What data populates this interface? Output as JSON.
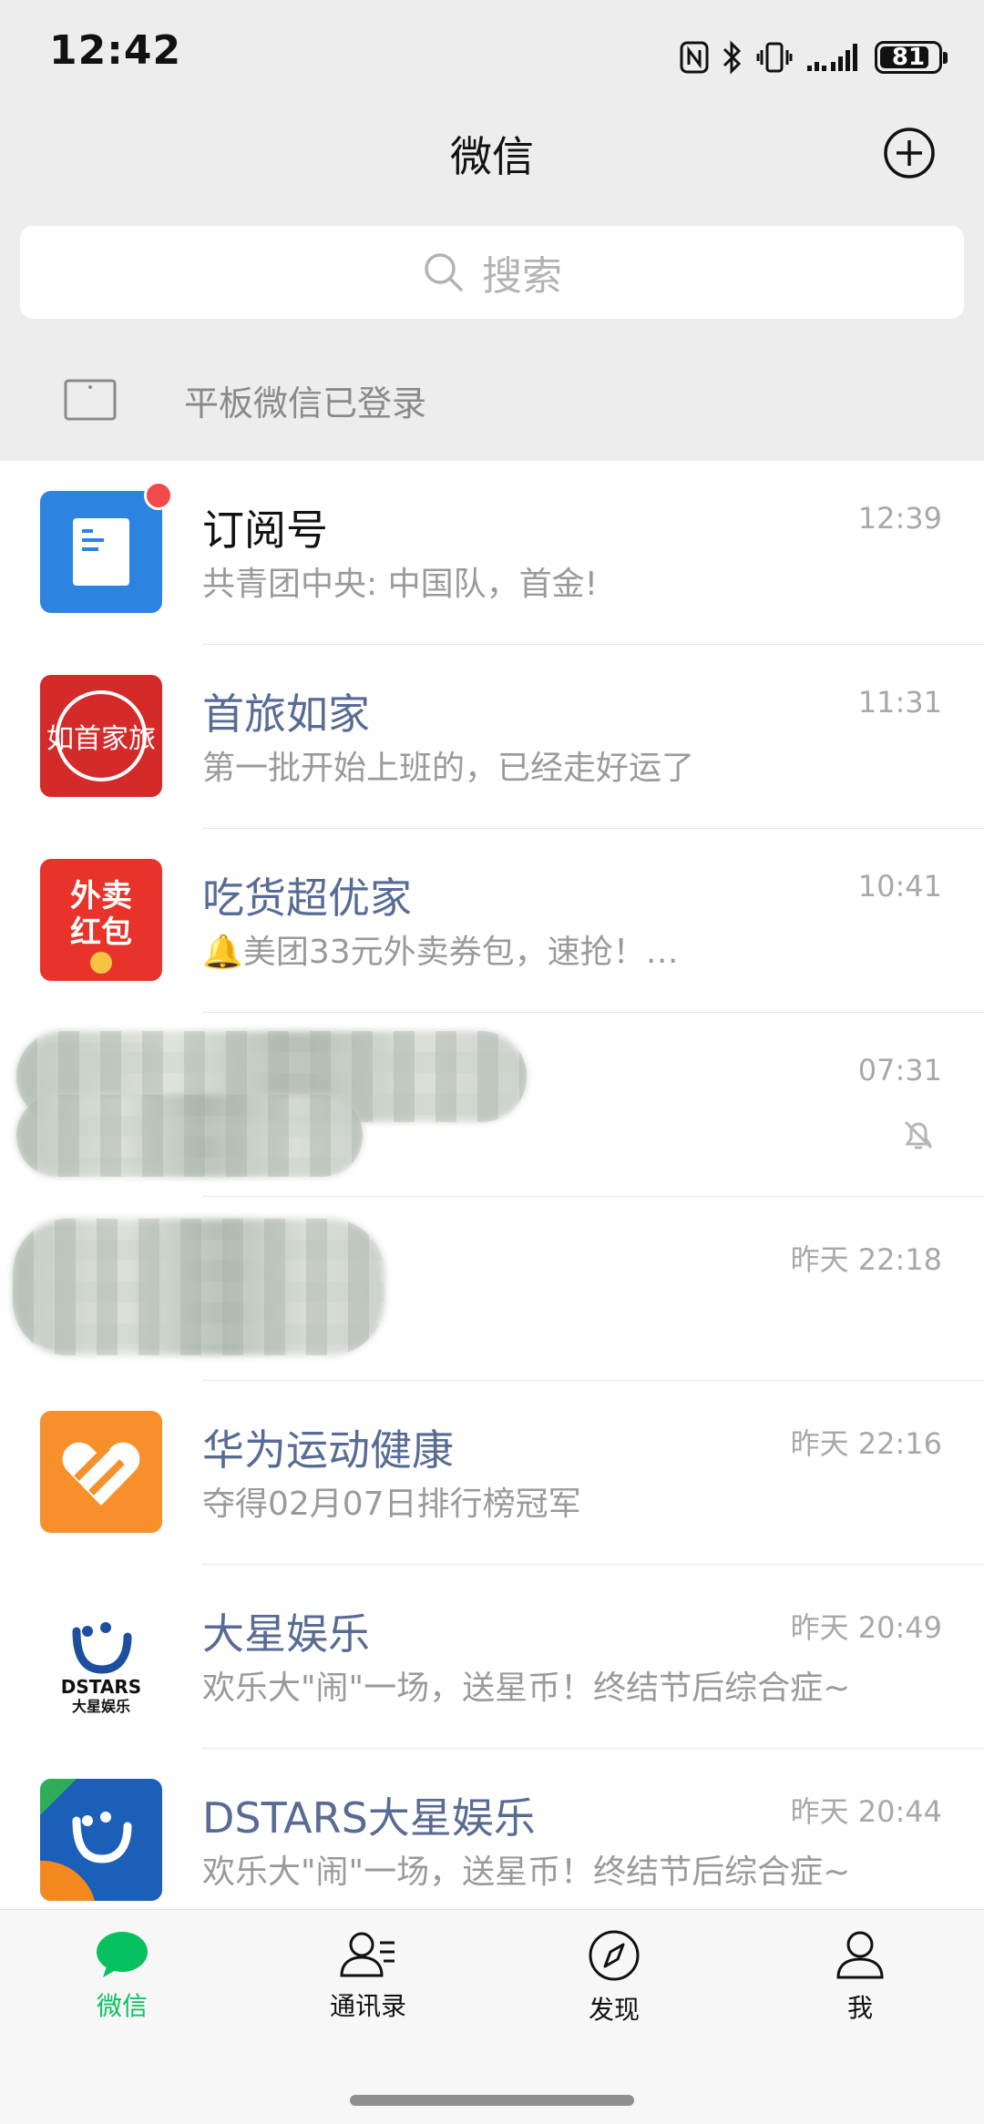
{
  "status_bar": {
    "time": "12:42",
    "battery": "81"
  },
  "header": {
    "title": "微信"
  },
  "search": {
    "placeholder": "搜索"
  },
  "tablet_login": {
    "text": "平板微信已登录"
  },
  "chats": [
    {
      "name": "订阅号",
      "message": "共青团中央: 中国队，首金!",
      "time": "12:39",
      "unread_dot": true
    },
    {
      "name": "首旅如家",
      "message": "第一批开始上班的，已经走好运了",
      "time": "11:31"
    },
    {
      "name": "吃货超优家",
      "message": "🔔美团33元外卖券包，速抢！…",
      "time": "10:41"
    },
    {
      "name": "",
      "message": "",
      "time": "07:31",
      "muted": true,
      "obscured": true
    },
    {
      "name": "",
      "message": "",
      "time": "昨天 22:18",
      "obscured": true
    },
    {
      "name": "华为运动健康",
      "message": "夺得02月07日排行榜冠军",
      "time": "昨天 22:16"
    },
    {
      "name": "大星娱乐",
      "message": "欢乐大\"闹\"一场，送星币！终结节后综合症~",
      "time": "昨天 20:49"
    },
    {
      "name": "DSTARS大星娱乐",
      "message": "欢乐大\"闹\"一场，送星币！终结节后综合症~",
      "time": "昨天 20:44"
    }
  ],
  "avatar_text": {
    "shouluru": "如首家旅",
    "waimai_line1": "外卖",
    "waimai_line2": "红包",
    "dstars_line1": "DSTARS",
    "dstars_line2": "大星娱乐"
  },
  "tabbar": {
    "tabs": [
      {
        "label": "微信",
        "active": true
      },
      {
        "label": "通讯录"
      },
      {
        "label": "发现"
      },
      {
        "label": "我"
      }
    ]
  },
  "colors": {
    "accent": "#07c160",
    "official_name": "#576b95",
    "unread": "#f24a4a"
  }
}
